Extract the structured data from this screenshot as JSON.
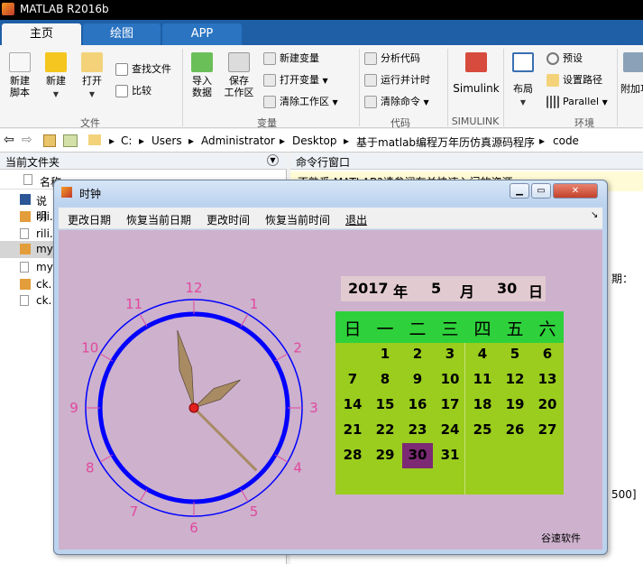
{
  "app": {
    "title": "MATLAB R2016b"
  },
  "tabs": [
    {
      "label": "主页"
    },
    {
      "label": "绘图"
    },
    {
      "label": "APP"
    }
  ],
  "ribbon": {
    "file": {
      "new_script": "新建\n脚本",
      "new": "新建",
      "open": "打开",
      "find_files": "查找文件",
      "compare": "比较",
      "group": "文件"
    },
    "variable": {
      "import": "导入\n数据",
      "save_ws": "保存\n工作区",
      "new_var": "新建变量",
      "open_var": "打开变量",
      "clear_ws": "清除工作区",
      "group": "变量"
    },
    "code": {
      "analyze": "分析代码",
      "run_time": "运行并计时",
      "clear_cmd": "清除命令",
      "group": "代码"
    },
    "simulink": {
      "label": "Simulink",
      "group": "SIMULINK"
    },
    "env": {
      "layout": "布局",
      "prefs": "预设",
      "set_path": "设置路径",
      "parallel": "Parallel",
      "group": "环境"
    },
    "addon": {
      "label": "附加功"
    }
  },
  "address": {
    "drive": "C:",
    "p1": "Users",
    "p2": "Administrator",
    "p3": "Desktop",
    "p4": "基于matlab编程万年历仿真源码程序",
    "p5": "code"
  },
  "left_pane": {
    "title": "当前文件夹",
    "col_name": "名称",
    "files": [
      "说明",
      "rili.",
      "rili.",
      "my",
      "my",
      "ck.",
      "ck."
    ]
  },
  "cmd_pane": {
    "title": "命令行窗口",
    "notice": "不熟悉 MATLAB?请参阅有关快速入门的资源。",
    "snippet1": "期：",
    "snippet2": "500]"
  },
  "figure": {
    "title": "时钟",
    "menu": [
      "更改日期",
      "恢复当前日期",
      "更改时间",
      "恢复当前时间",
      "退出"
    ],
    "brand": "谷速软件"
  },
  "clock": {
    "numbers": [
      "12",
      "1",
      "2",
      "3",
      "4",
      "5",
      "6",
      "7",
      "8",
      "9",
      "10",
      "11"
    ],
    "hour": 1,
    "minute": 58,
    "second": 22.5
  },
  "date_display": {
    "year": "2017",
    "year_label": "年",
    "month": "5",
    "month_label": "月",
    "day": "30",
    "day_label": "日"
  },
  "calendar": {
    "weekdays": [
      "日",
      "一",
      "二",
      "三",
      "四",
      "五",
      "六"
    ],
    "weeks": [
      [
        "",
        "1",
        "2",
        "3",
        "4",
        "5",
        "6"
      ],
      [
        "7",
        "8",
        "9",
        "10",
        "11",
        "12",
        "13"
      ],
      [
        "14",
        "15",
        "16",
        "17",
        "18",
        "19",
        "20"
      ],
      [
        "21",
        "22",
        "23",
        "24",
        "25",
        "26",
        "27"
      ],
      [
        "28",
        "29",
        "30",
        "31",
        "",
        "",
        ""
      ]
    ],
    "today": "30"
  },
  "colors": {
    "clock_ring": "#0000ff",
    "clock_numbers": "#e0489d",
    "hand": "#a88b62",
    "today_bg": "#7b2a73",
    "calendar_bg": "#9acd1e",
    "header_bg": "#2ed13b"
  }
}
